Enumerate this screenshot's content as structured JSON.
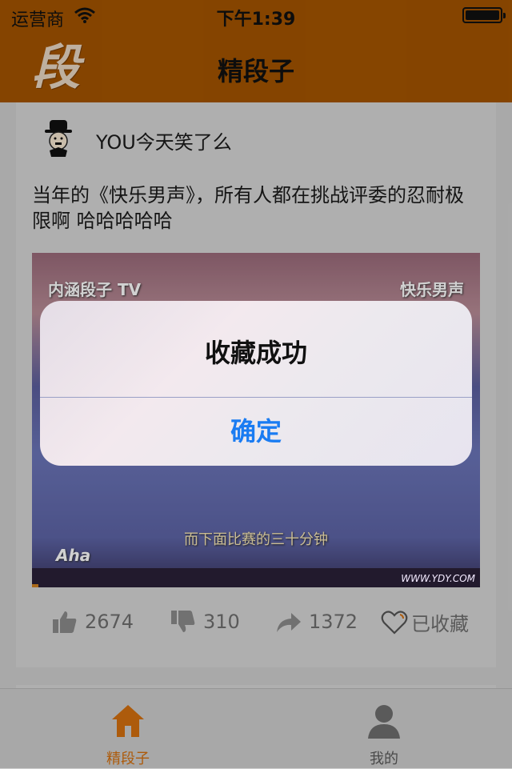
{
  "status": {
    "carrier": "运营商",
    "time": "下午1:39"
  },
  "nav": {
    "title": "精段子",
    "logo_text": "段"
  },
  "post": {
    "author": "YOU今天笑了么",
    "text": "当年的《快乐男声》，所有人都在挑战评委的忍耐极限啊 哈哈哈哈哈",
    "video": {
      "overlay_left": "内涵段子 TV",
      "overlay_right": "快乐男声",
      "subtitle": "而下面比赛的三十分钟",
      "brand": "Aha",
      "url": "WWW.YDY.COM"
    },
    "actions": {
      "likes": "2674",
      "dislikes": "310",
      "shares": "1372",
      "favorite_label": "已收藏"
    }
  },
  "tabbar": {
    "tabs": [
      {
        "label": "精段子",
        "icon": "home-icon",
        "active": true
      },
      {
        "label": "我的",
        "icon": "person-icon",
        "active": false
      }
    ]
  },
  "alert": {
    "title": "收藏成功",
    "confirm_label": "确定"
  },
  "colors": {
    "nav_bg": "#a35400",
    "accent": "#d3700f",
    "link_blue": "#1a7cf2"
  }
}
